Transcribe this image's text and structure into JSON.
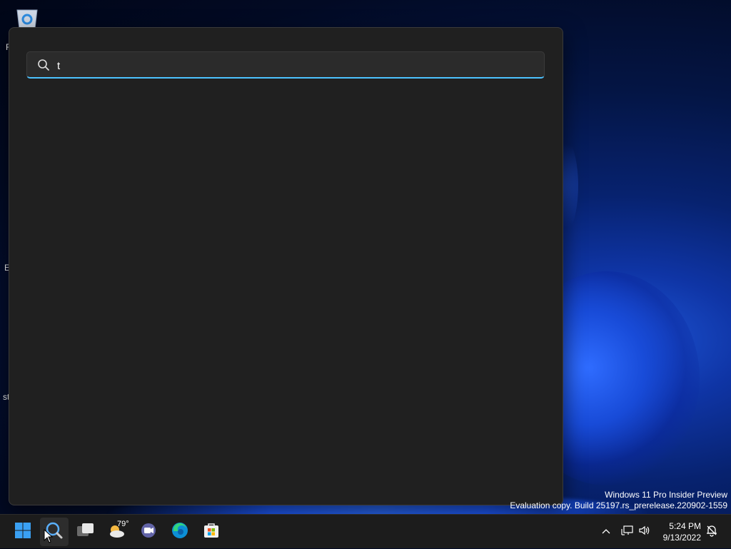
{
  "search": {
    "query": "t",
    "placeholder": ""
  },
  "desktop": {
    "labels": [
      "R",
      "E",
      "st"
    ]
  },
  "watermark": {
    "line1": "Windows 11 Pro Insider Preview",
    "line2": "Evaluation copy. Build 25197.rs_prerelease.220902-1559"
  },
  "taskbar": {
    "weather_temp": "79°",
    "time": "5:24 PM",
    "date": "9/13/2022",
    "icons": [
      "windows-start-icon",
      "search-icon",
      "task-view-icon",
      "weather-icon",
      "teams-chat-icon",
      "edge-icon",
      "store-icon"
    ]
  },
  "colors": {
    "accent": "#4cc2ff",
    "panel": "#202020",
    "taskbar": "#1c1c1c"
  }
}
